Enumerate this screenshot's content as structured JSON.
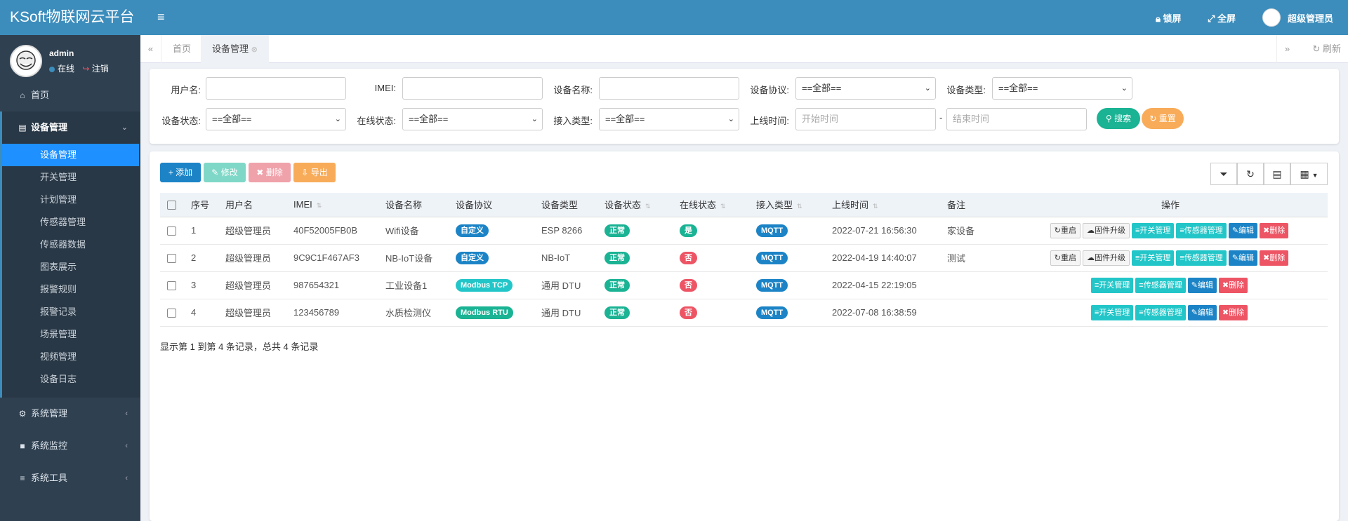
{
  "brand": "KSoft物联网云平台",
  "user": {
    "name": "admin",
    "status": "在线",
    "logout": "注销"
  },
  "nav": {
    "home": "首页",
    "device_mgmt": "设备管理",
    "sub": [
      "设备管理",
      "开关管理",
      "计划管理",
      "传感器管理",
      "传感器数据",
      "图表展示",
      "报警规则",
      "报警记录",
      "场景管理",
      "视频管理",
      "设备日志"
    ],
    "system_mgmt": "系统管理",
    "system_monitor": "系统监控",
    "system_tools": "系统工具"
  },
  "topbar": {
    "lock": "锁屏",
    "fullscreen": "全屏",
    "admin": "超级管理员"
  },
  "tabs": {
    "home": "首页",
    "device": "设备管理",
    "refresh": "刷新"
  },
  "search": {
    "username_label": "用户名:",
    "imei_label": "IMEI:",
    "device_name_label": "设备名称:",
    "protocol_label": "设备协议:",
    "protocol_value": "==全部==",
    "type_label": "设备类型:",
    "type_value": "==全部==",
    "status_label": "设备状态:",
    "status_value": "==全部==",
    "online_label": "在线状态:",
    "online_value": "==全部==",
    "access_label": "接入类型:",
    "access_value": "==全部==",
    "time_label": "上线时间:",
    "start_placeholder": "开始时间",
    "dash": "-",
    "end_placeholder": "结束时间",
    "search_btn": "搜索",
    "reset_btn": "重置"
  },
  "toolbar": {
    "add": "添加",
    "edit": "修改",
    "delete": "删除",
    "export": "导出"
  },
  "table": {
    "headers": [
      "序号",
      "用户名",
      "IMEI",
      "设备名称",
      "设备协议",
      "设备类型",
      "设备状态",
      "在线状态",
      "接入类型",
      "上线时间",
      "备注",
      "操作"
    ],
    "rows": [
      {
        "no": "1",
        "user": "超级管理员",
        "imei": "40F52005FB0B",
        "name": "Wifi设备",
        "protocol": "自定义",
        "type": "ESP 8266",
        "status": "正常",
        "online": "是",
        "access": "MQTT",
        "time": "2022-07-21 16:56:30",
        "remark": "家设备"
      },
      {
        "no": "2",
        "user": "超级管理员",
        "imei": "9C9C1F467AF3",
        "name": "NB-IoT设备",
        "protocol": "自定义",
        "type": "NB-IoT",
        "status": "正常",
        "online": "否",
        "access": "MQTT",
        "time": "2022-04-19 14:40:07",
        "remark": "测试"
      },
      {
        "no": "3",
        "user": "超级管理员",
        "imei": "987654321",
        "name": "工业设备1",
        "protocol": "Modbus TCP",
        "type": "通用 DTU",
        "status": "正常",
        "online": "否",
        "access": "MQTT",
        "time": "2022-04-15 22:19:05",
        "remark": ""
      },
      {
        "no": "4",
        "user": "超级管理员",
        "imei": "123456789",
        "name": "水质检测仪",
        "protocol": "Modbus RTU",
        "type": "通用 DTU",
        "status": "正常",
        "online": "否",
        "access": "MQTT",
        "time": "2022-07-08 16:38:59",
        "remark": ""
      }
    ],
    "actions": {
      "restart": "重启",
      "firmware": "固件升级",
      "switch": "开关管理",
      "sensor": "传感器管理",
      "edit": "编辑",
      "delete": "删除"
    }
  },
  "pagination": "显示第 1 到第 4 条记录，总共 4 条记录",
  "colors": {
    "primary": "#3c8dbc",
    "sidebar": "#2f4050",
    "success": "#1ab394",
    "danger": "#ed5565",
    "warning": "#f8ac59",
    "info": "#23c6c8"
  }
}
